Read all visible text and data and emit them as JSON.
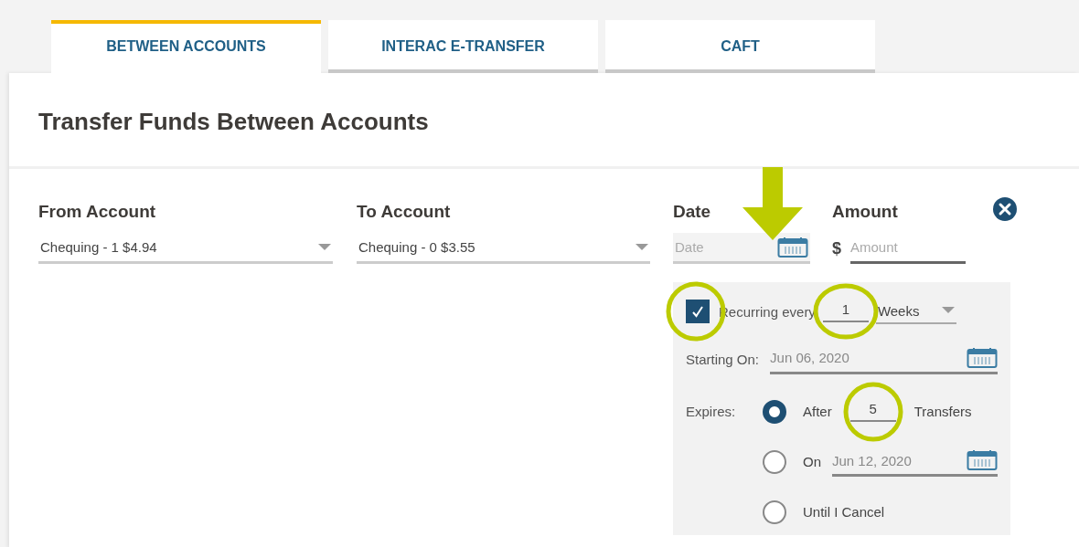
{
  "tabs": [
    {
      "label": "BETWEEN ACCOUNTS",
      "selected": true
    },
    {
      "label": "INTERAC E-TRANSFER",
      "selected": false
    },
    {
      "label": "CAFT",
      "selected": false
    }
  ],
  "title": "Transfer Funds Between Accounts",
  "form": {
    "from": {
      "label": "From Account",
      "value": "Chequing - 1 $4.94"
    },
    "to": {
      "label": "To Account",
      "value": "Chequing - 0 $3.55"
    },
    "date": {
      "label": "Date",
      "placeholder": "Date",
      "pointed": true
    },
    "amount": {
      "label": "Amount",
      "currency": "$",
      "placeholder": "Amount"
    }
  },
  "recurring": {
    "checked": true,
    "highlighted": true,
    "label": "Recurring every",
    "interval": {
      "value": "1",
      "highlighted": true
    },
    "unit": "Weeks",
    "starting_label": "Starting On:",
    "starting_date": "Jun 06, 2020",
    "expires_label": "Expires:",
    "options": [
      {
        "kind": "count",
        "selected": true,
        "label": "After",
        "value": "5",
        "suffix": "Transfers",
        "highlighted": true
      },
      {
        "kind": "date",
        "selected": false,
        "label": "On",
        "value": "Jun 12, 2020"
      },
      {
        "kind": "plain",
        "selected": false,
        "label": "Until I Cancel"
      }
    ]
  }
}
